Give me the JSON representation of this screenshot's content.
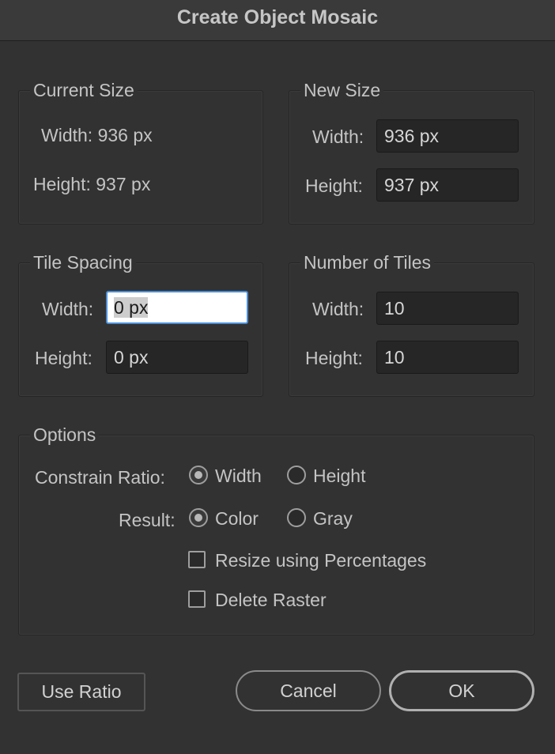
{
  "window": {
    "title": "Create Object Mosaic"
  },
  "current_size": {
    "legend": "Current Size",
    "width_text": "Width: 936 px",
    "height_text": "Height: 937 px"
  },
  "new_size": {
    "legend": "New Size",
    "width_label": "Width:",
    "width_value": "936 px",
    "height_label": "Height:",
    "height_value": "937 px"
  },
  "tile_spacing": {
    "legend": "Tile Spacing",
    "width_label": "Width:",
    "width_value": "0 px",
    "height_label": "Height:",
    "height_value": "0 px"
  },
  "number_of_tiles": {
    "legend": "Number of Tiles",
    "width_label": "Width:",
    "width_value": "10",
    "height_label": "Height:",
    "height_value": "10"
  },
  "options": {
    "legend": "Options",
    "constrain_label": "Constrain Ratio:",
    "constrain_width": "Width",
    "constrain_height": "Height",
    "constrain_selected": "Width",
    "result_label": "Result:",
    "result_color": "Color",
    "result_gray": "Gray",
    "result_selected": "Color",
    "resize_percentages": "Resize using Percentages",
    "resize_percentages_checked": false,
    "delete_raster": "Delete Raster",
    "delete_raster_checked": false
  },
  "buttons": {
    "use_ratio": "Use Ratio",
    "cancel": "Cancel",
    "ok": "OK"
  }
}
